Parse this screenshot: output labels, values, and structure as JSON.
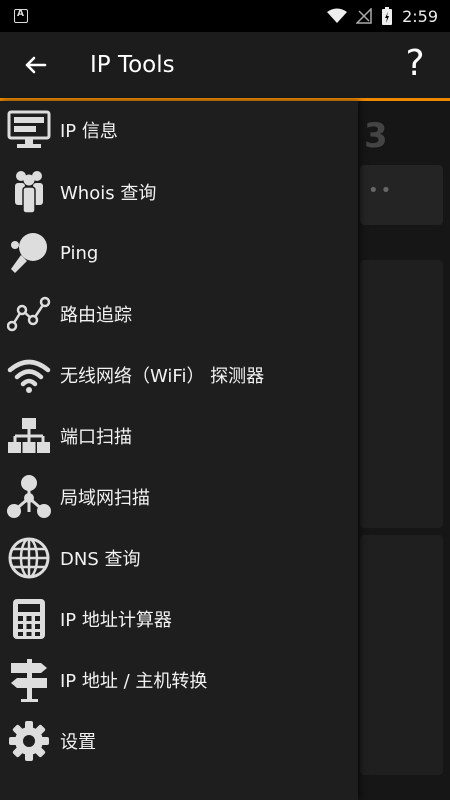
{
  "status_bar": {
    "time": "2:59"
  },
  "app_bar": {
    "title": "IP Tools",
    "help_label": "?"
  },
  "background": {
    "partial_char": "3",
    "partial_dots": "••"
  },
  "menu": [
    {
      "label": "IP 信息",
      "icon": "monitor-icon"
    },
    {
      "label": "Whois 查询",
      "icon": "people-icon"
    },
    {
      "label": "Ping",
      "icon": "ping-pong-icon"
    },
    {
      "label": "路由追踪",
      "icon": "route-icon"
    },
    {
      "label": "无线网络（WiFi） 探测器",
      "icon": "wifi-icon"
    },
    {
      "label": "端口扫描",
      "icon": "network-ports-icon"
    },
    {
      "label": "局域网扫描",
      "icon": "lan-icon"
    },
    {
      "label": "DNS 查询",
      "icon": "globe-icon"
    },
    {
      "label": "IP 地址计算器",
      "icon": "calculator-icon"
    },
    {
      "label": "IP 地址 / 主机转换",
      "icon": "signpost-icon"
    },
    {
      "label": "设置",
      "icon": "gear-icon"
    }
  ]
}
